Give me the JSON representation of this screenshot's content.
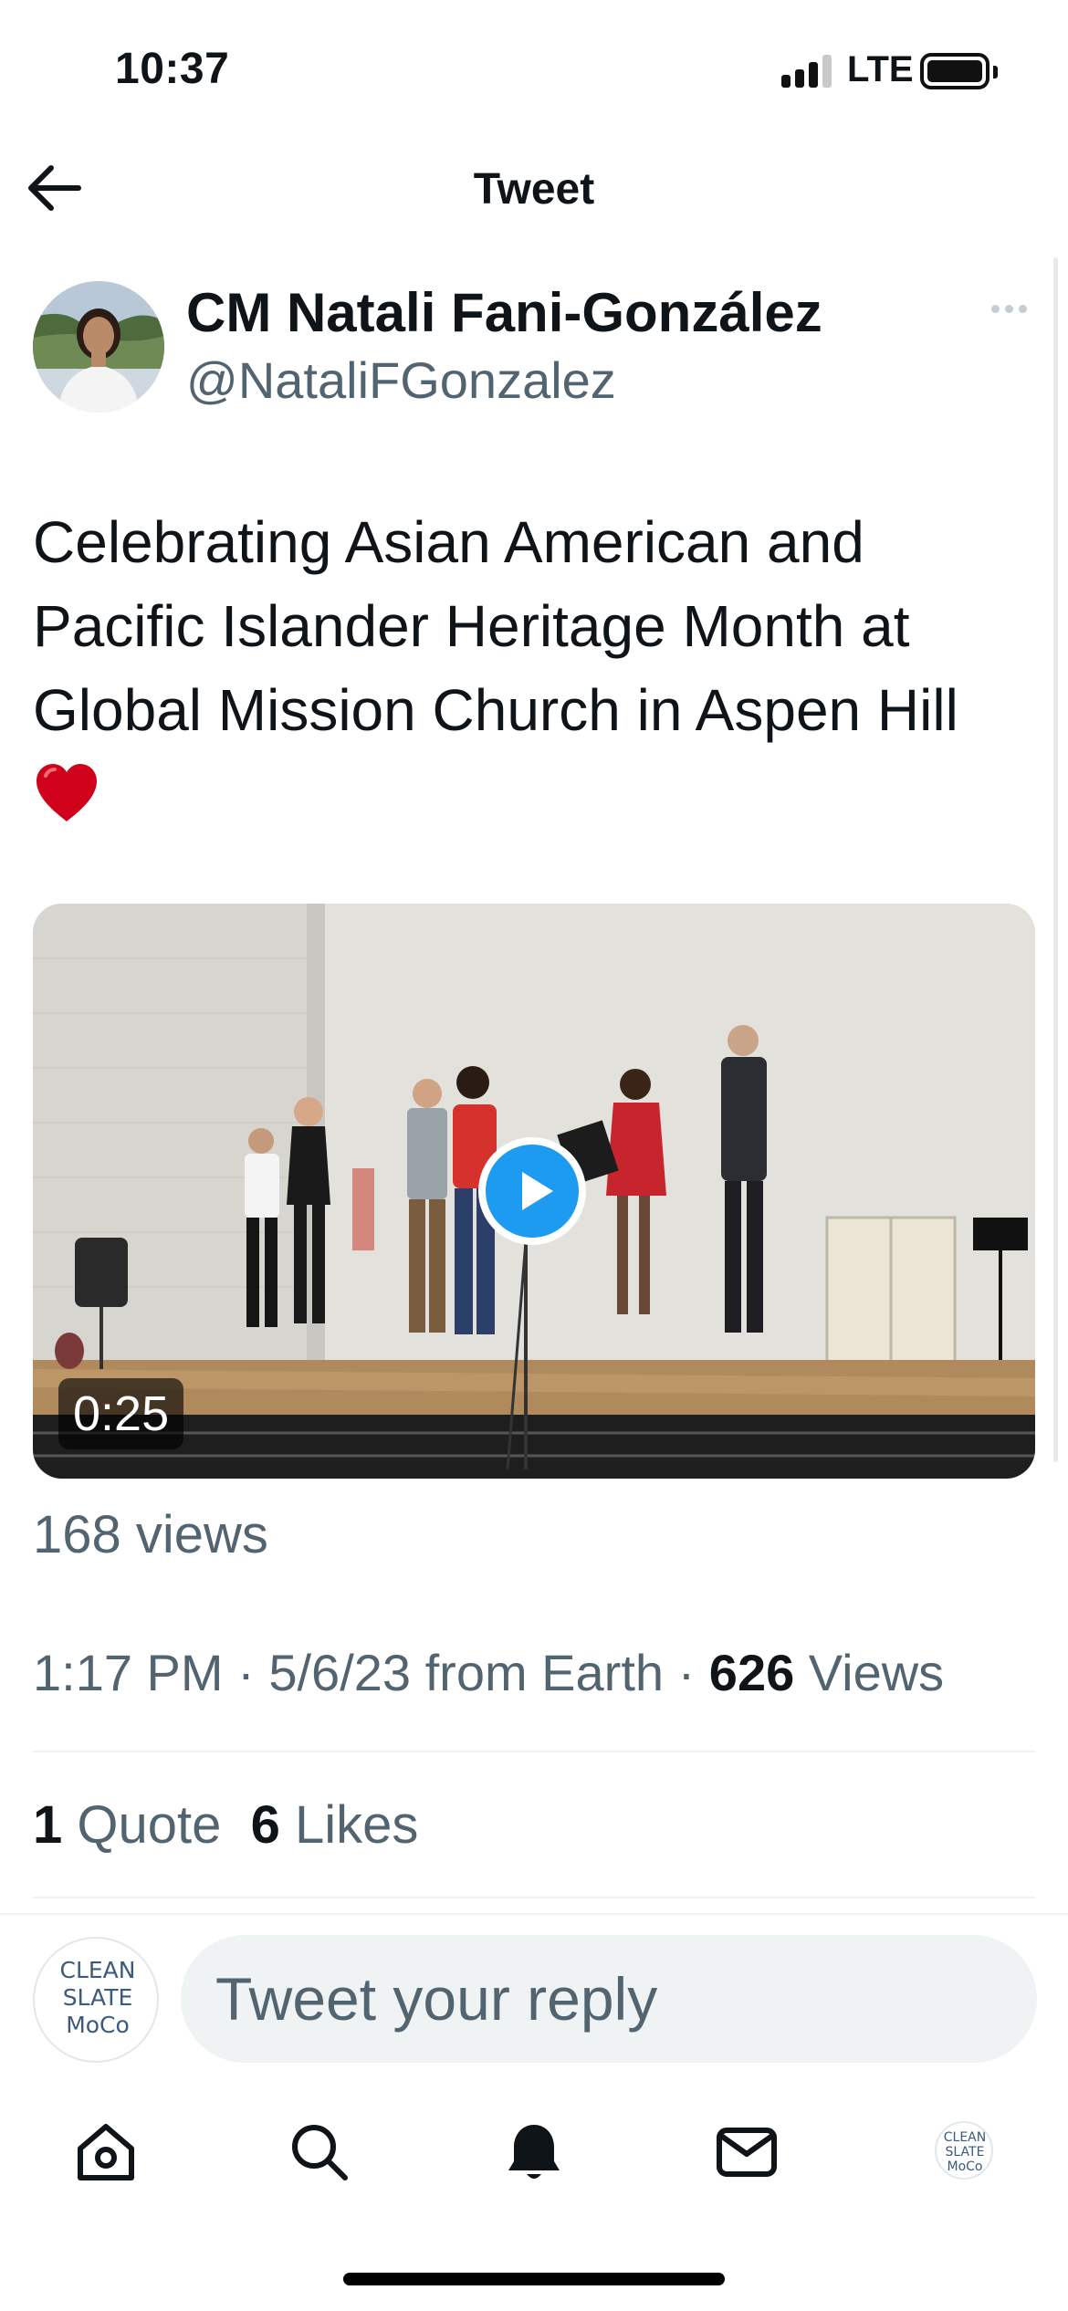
{
  "status_bar": {
    "time": "10:37",
    "network": "LTE",
    "signal_bars": 3,
    "signal_bars_total": 4
  },
  "header": {
    "title": "Tweet"
  },
  "tweet": {
    "author_name": "CM Natali Fani-González",
    "author_handle": "@NataliFGonzalez",
    "text": "Celebrating Asian American and Pacific Islander Heritage Month at Global Mission Church in Aspen Hill",
    "emoji": "red-heart",
    "video": {
      "duration": "0:25",
      "views": "168 views"
    },
    "time": "1:17 PM",
    "date": "5/6/23",
    "source": "from Earth",
    "view_count": "626",
    "view_label": "Views",
    "quote_count": "1",
    "quote_label": "Quote",
    "like_count": "6",
    "like_label": "Likes",
    "separator": "·"
  },
  "reply": {
    "placeholder": "Tweet your reply",
    "avatar_text": [
      "CLEAN",
      "SLATE",
      "MoCo"
    ]
  },
  "tab_bar": {
    "items": [
      "home-icon",
      "search-icon",
      "notifications-icon",
      "messages-icon",
      "profile-avatar"
    ]
  },
  "colors": {
    "accent": "#1d9bf0",
    "text": "#0f1419",
    "secondary": "#536471",
    "heart": "#d0021b"
  }
}
